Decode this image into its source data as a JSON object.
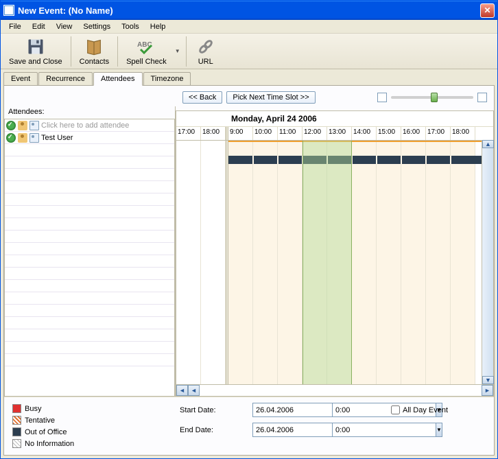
{
  "title": "New Event: (No Name)",
  "menu": [
    "File",
    "Edit",
    "View",
    "Settings",
    "Tools",
    "Help"
  ],
  "toolbar": [
    {
      "id": "save-close",
      "label": "Save and Close"
    },
    {
      "id": "contacts",
      "label": "Contacts"
    },
    {
      "id": "spell",
      "label": "Spell Check"
    },
    {
      "id": "url",
      "label": "URL"
    }
  ],
  "tabs": [
    "Event",
    "Recurrence",
    "Attendees",
    "Timezone"
  ],
  "active_tab": 2,
  "nav": {
    "back": "<< Back",
    "next": "Pick Next Time Slot >>"
  },
  "attendees_header": "Attendees:",
  "attendee_placeholder": "Click here to add attendee",
  "attendees": [
    {
      "name": "Test User"
    }
  ],
  "date_heading": "Monday, April 24 2006",
  "off_hours": [
    "17:00",
    "18:00"
  ],
  "day_hours": [
    "9:00",
    "10:00",
    "11:00",
    "12:00",
    "13:00",
    "14:00",
    "15:00",
    "16:00",
    "17:00",
    "18:00"
  ],
  "highlight": {
    "start_idx": 3,
    "span": 2
  },
  "legend": [
    {
      "label": "Busy",
      "color": "#e03030",
      "pattern": "solid"
    },
    {
      "label": "Tentative",
      "color": "#e07030",
      "pattern": "hatch"
    },
    {
      "label": "Out of Office",
      "color": "#2c3e50",
      "pattern": "solid"
    },
    {
      "label": "No Information",
      "color": "#d0d0d0",
      "pattern": "hatch-light"
    }
  ],
  "form": {
    "start_label": "Start Date:",
    "end_label": "End Date:",
    "start_date": "26.04.2006",
    "end_date": "26.04.2006",
    "start_time": "0:00",
    "end_time": "0:00",
    "all_day_label": "All Day Event",
    "all_day": false
  }
}
